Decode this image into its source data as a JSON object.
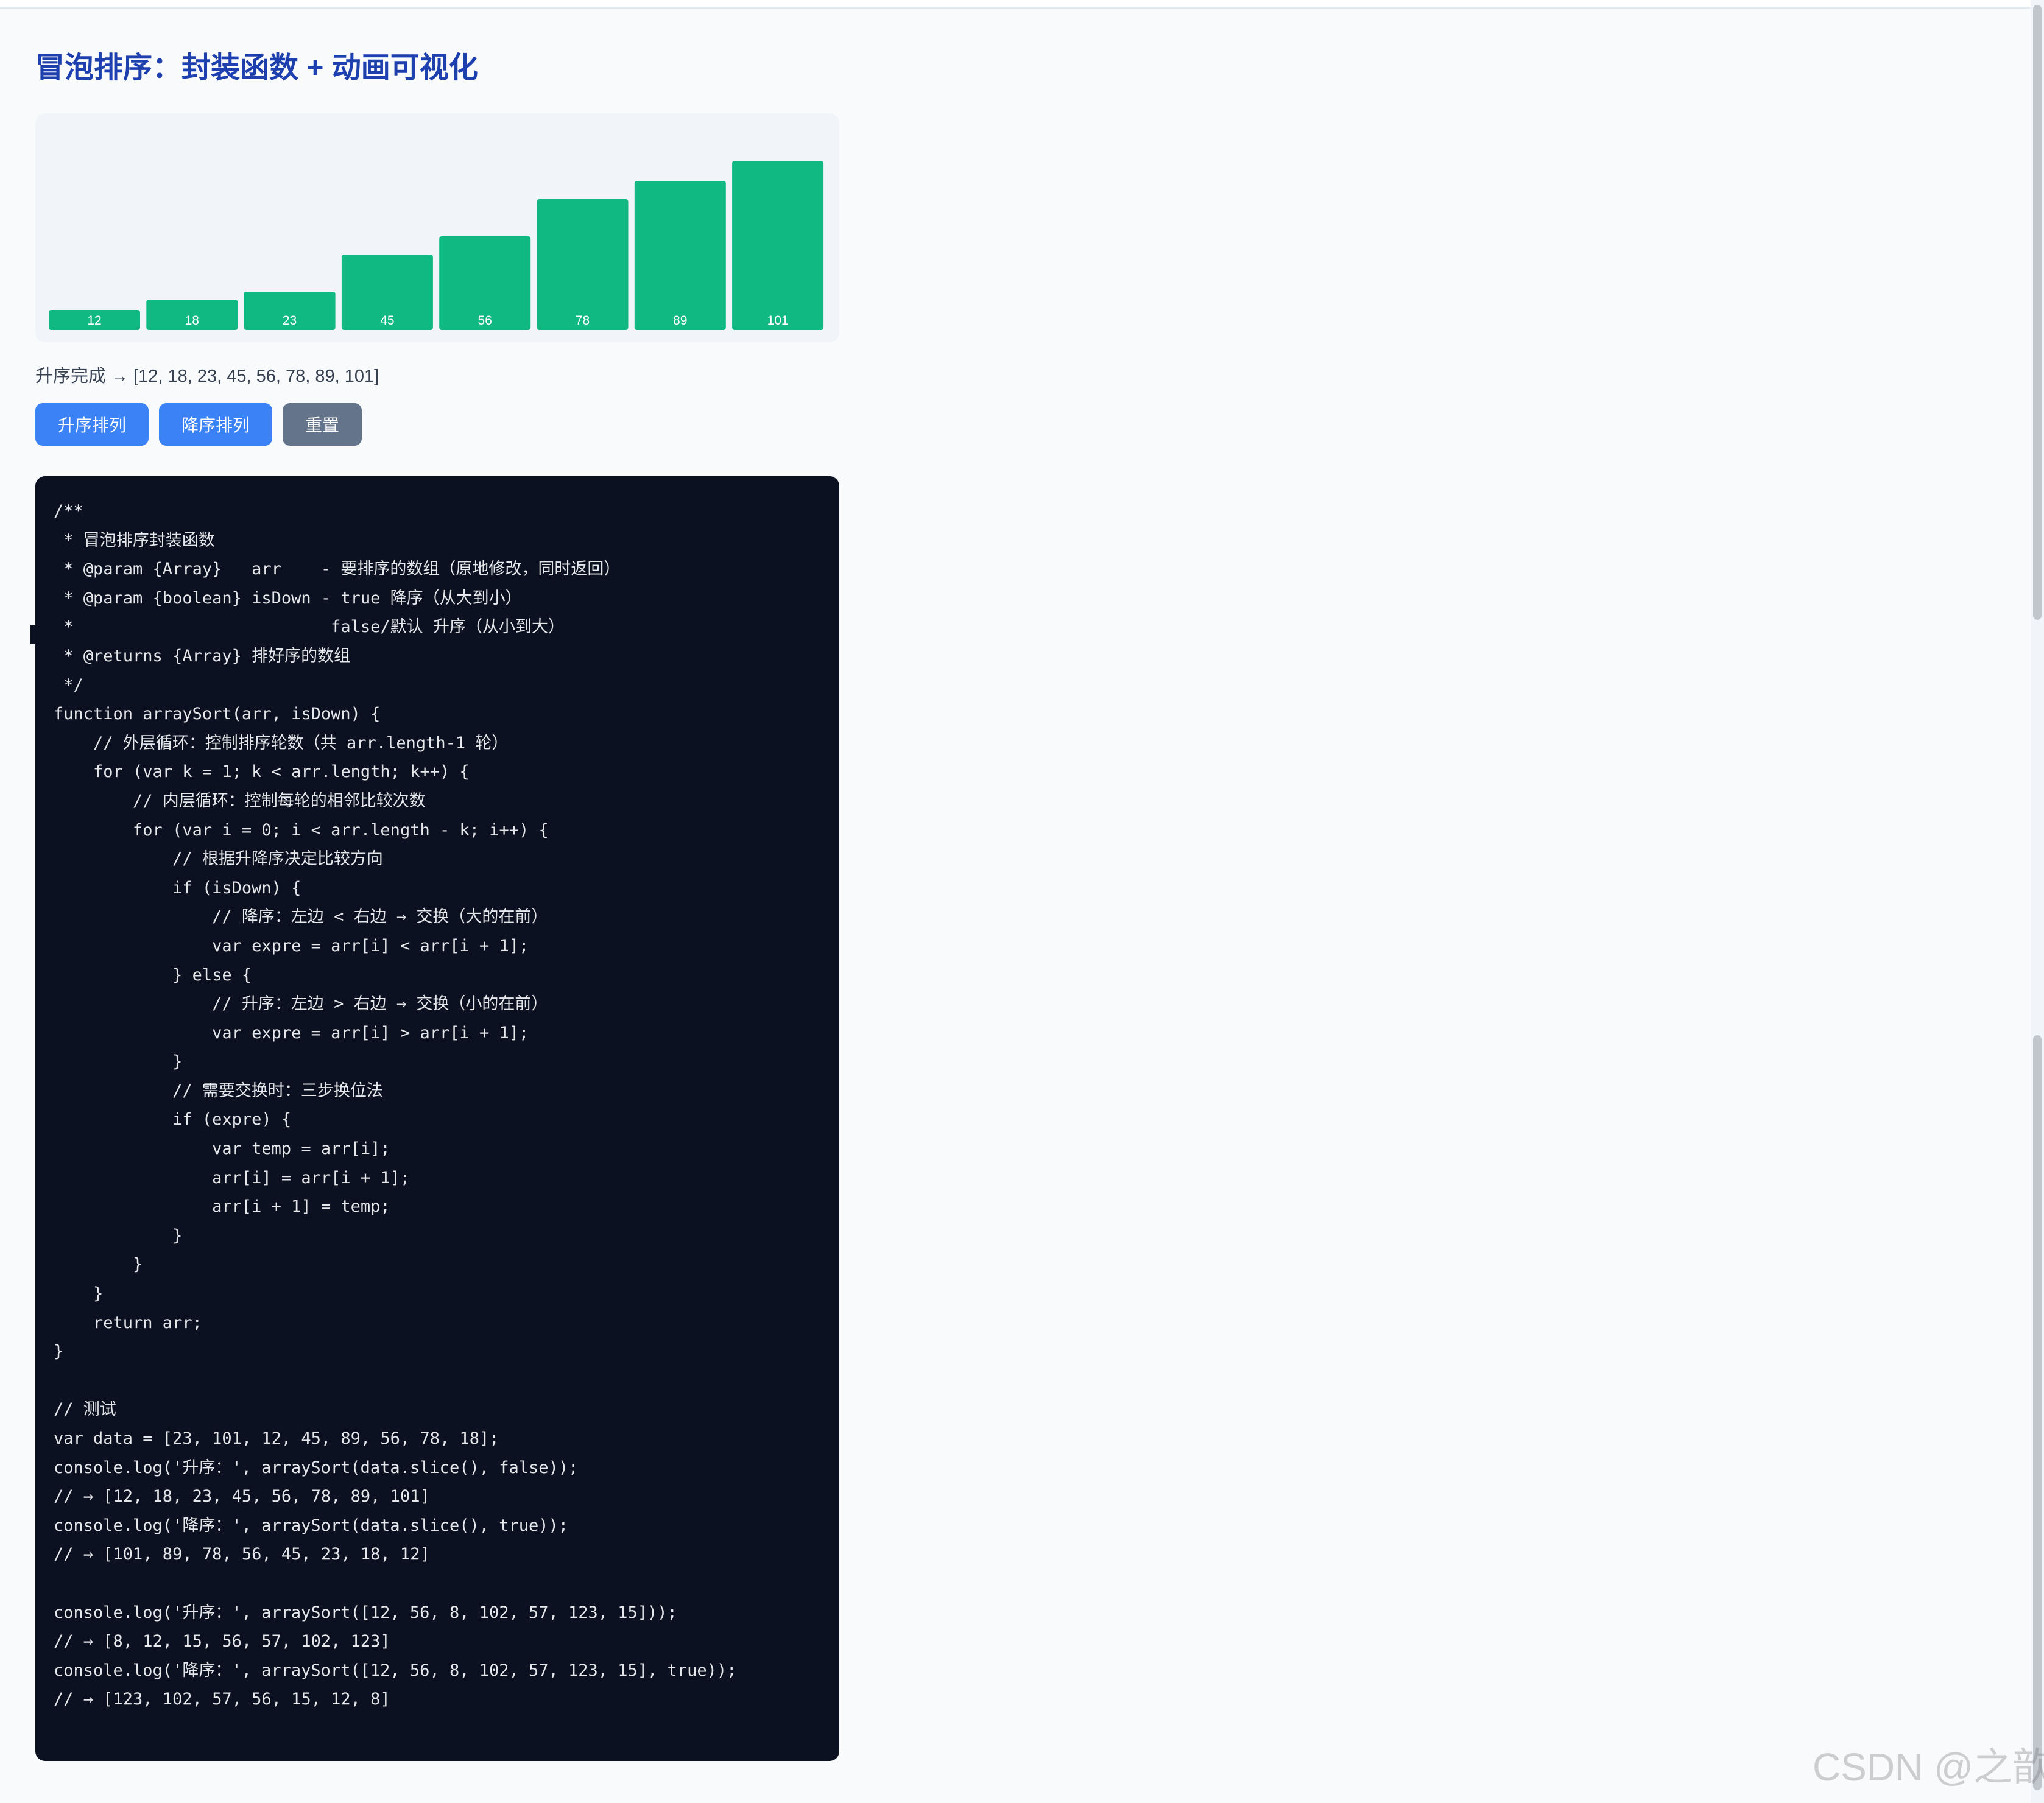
{
  "page": {
    "title": "冒泡排序：封装函数 + 动画可视化"
  },
  "bars": {
    "values": [
      12,
      18,
      23,
      45,
      56,
      78,
      89,
      101
    ],
    "color": "#10b981",
    "max": 101
  },
  "status": {
    "text": "升序完成 → [12, 18, 23, 45, 56, 78, 89, 101]"
  },
  "buttons": {
    "asc_label": "升序排列",
    "desc_label": "降序排列",
    "reset_label": "重置"
  },
  "code": {
    "lines": [
      "/**",
      " * 冒泡排序封装函数",
      " * @param {Array}   arr    - 要排序的数组（原地修改，同时返回）",
      " * @param {boolean} isDown - true 降序（从大到小）",
      " *                          false/默认 升序（从小到大）",
      " * @returns {Array} 排好序的数组",
      " */",
      "function arraySort(arr, isDown) {",
      "    // 外层循环：控制排序轮数（共 arr.length-1 轮）",
      "    for (var k = 1; k < arr.length; k++) {",
      "        // 内层循环：控制每轮的相邻比较次数",
      "        for (var i = 0; i < arr.length - k; i++) {",
      "            // 根据升降序决定比较方向",
      "            if (isDown) {",
      "                // 降序：左边 < 右边 → 交换（大的在前）",
      "                var expre = arr[i] < arr[i + 1];",
      "            } else {",
      "                // 升序：左边 > 右边 → 交换（小的在前）",
      "                var expre = arr[i] > arr[i + 1];",
      "            }",
      "            // 需要交换时：三步换位法",
      "            if (expre) {",
      "                var temp = arr[i];",
      "                arr[i] = arr[i + 1];",
      "                arr[i + 1] = temp;",
      "            }",
      "        }",
      "    }",
      "    return arr;",
      "}",
      "",
      "// 测试",
      "var data = [23, 101, 12, 45, 89, 56, 78, 18];",
      "console.log('升序：', arraySort(data.slice(), false));",
      "// → [12, 18, 23, 45, 56, 78, 89, 101]",
      "console.log('降序：', arraySort(data.slice(), true));",
      "// → [101, 89, 78, 56, 45, 23, 18, 12]",
      "",
      "console.log('升序：', arraySort([12, 56, 8, 102, 57, 123, 15]));",
      "// → [8, 12, 15, 56, 57, 102, 123]",
      "console.log('降序：', arraySort([12, 56, 8, 102, 57, 123, 15], true));",
      "// → [123, 102, 57, 56, 15, 12, 8]"
    ]
  },
  "watermark": {
    "text": "CSDN @之歆"
  },
  "colors": {
    "title": "#1e40af",
    "button_primary": "#3b82f6",
    "button_secondary": "#64748b",
    "code_background": "#0b1120"
  }
}
